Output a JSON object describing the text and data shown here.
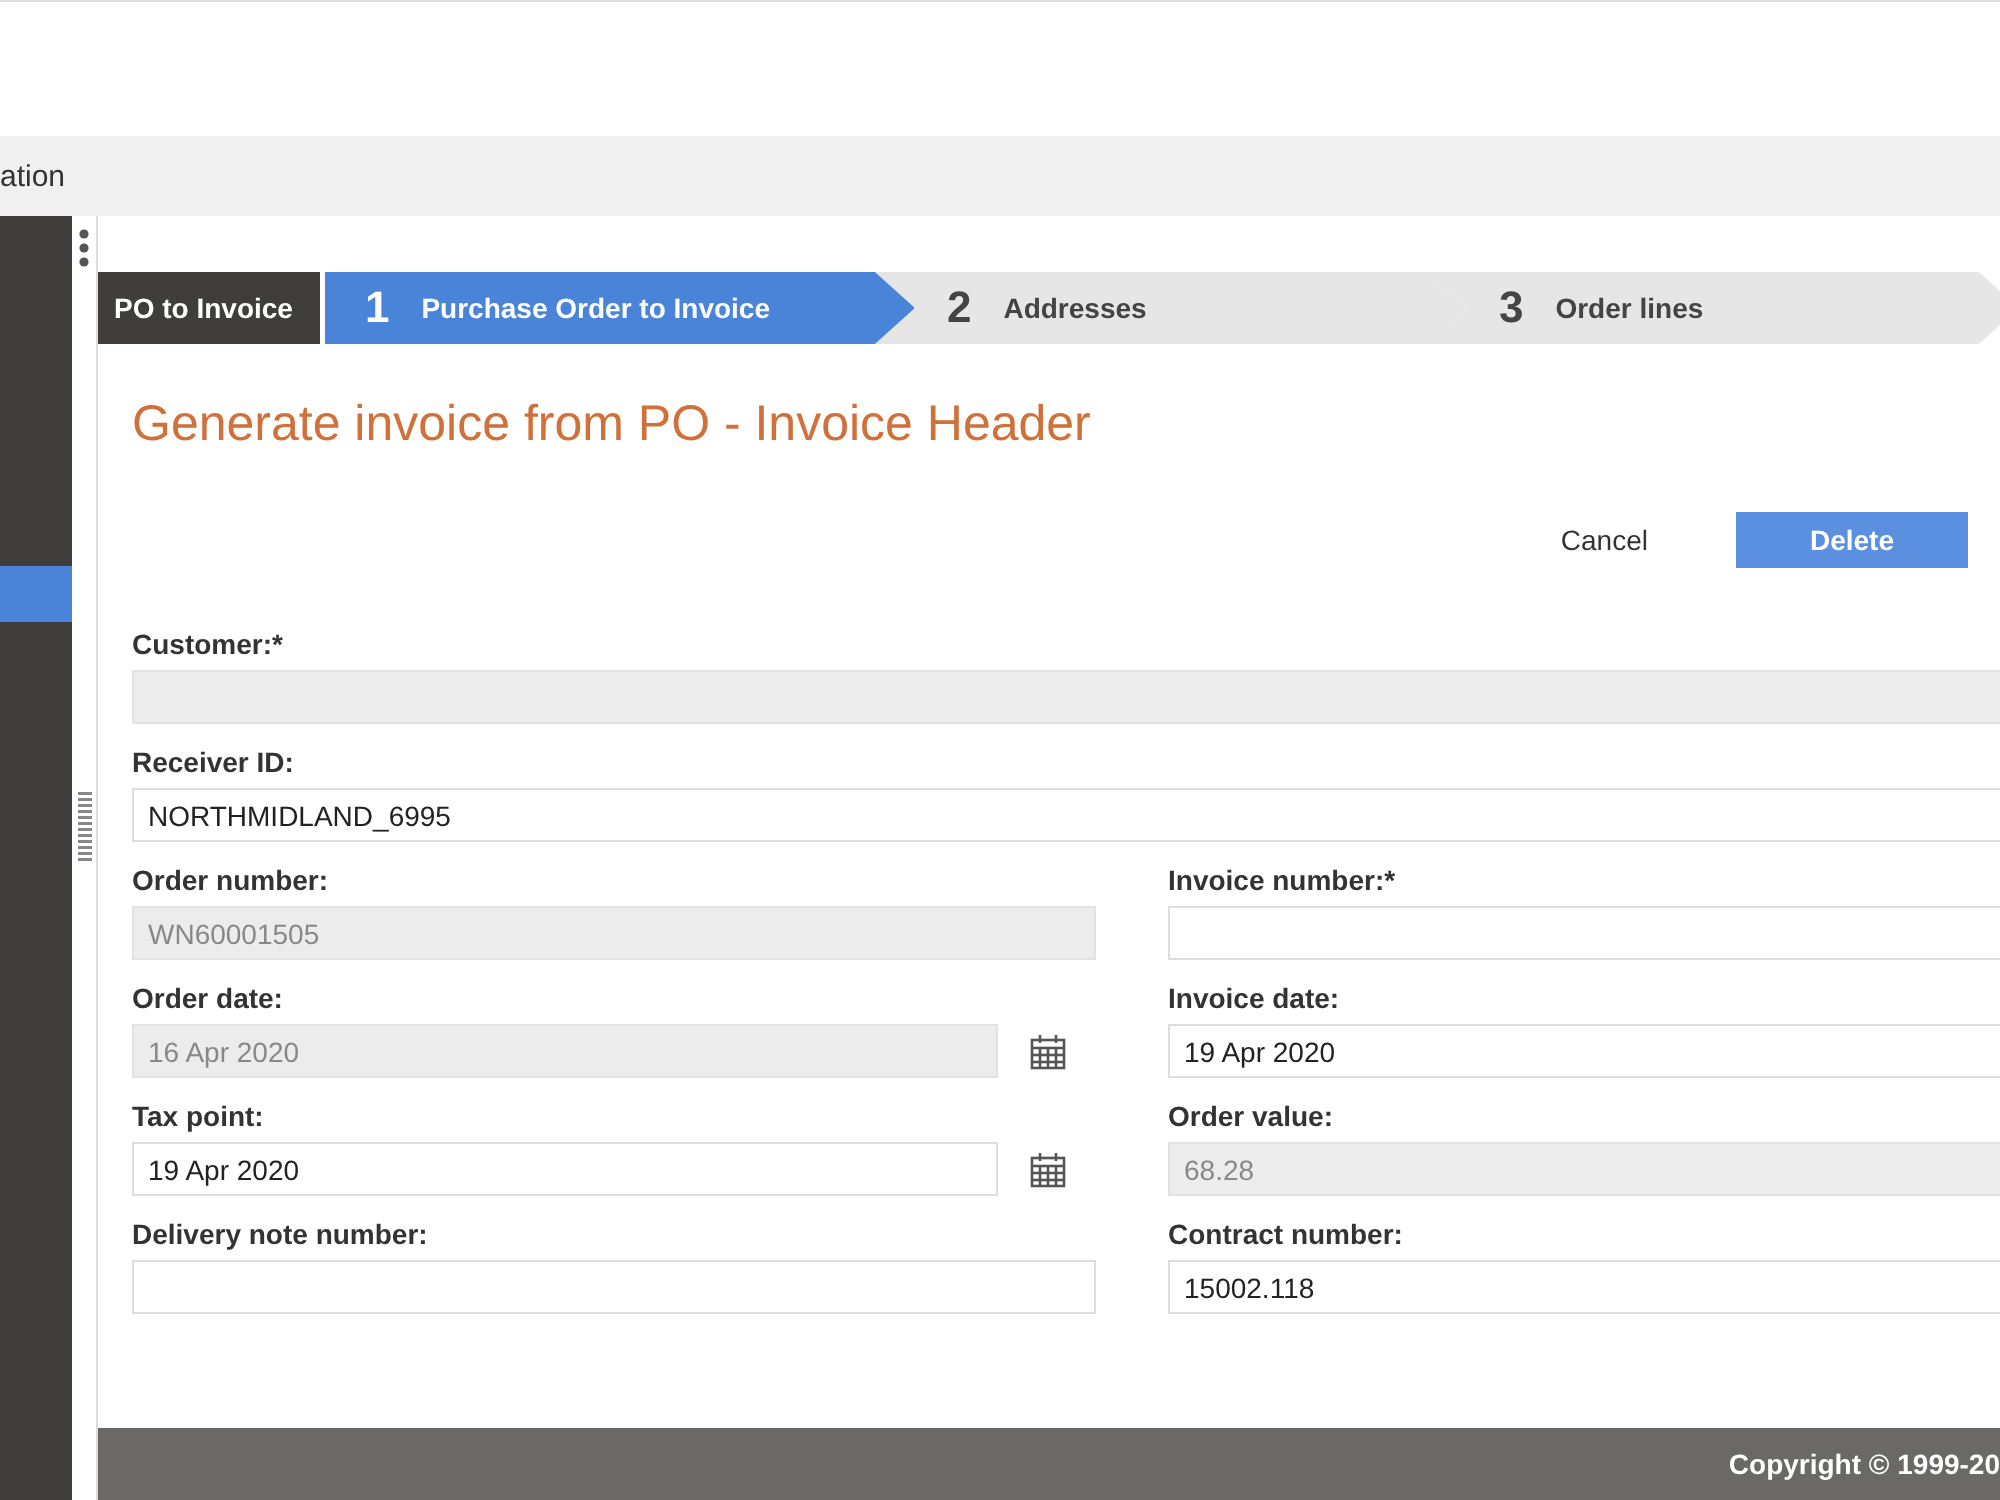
{
  "top_bar": {
    "title": "ation"
  },
  "sidebar": {
    "items": [
      {
        "selected": true
      }
    ]
  },
  "wizard": {
    "name": "PO to Invoice",
    "steps": [
      {
        "number": "1",
        "label": "Purchase Order to Invoice",
        "selected": true
      },
      {
        "number": "2",
        "label": "Addresses",
        "selected": false
      },
      {
        "number": "3",
        "label": "Order lines",
        "selected": false
      }
    ]
  },
  "page_title": "Generate invoice from PO - Invoice Header",
  "buttons": [
    {
      "label": "Cancel",
      "kind": "link"
    },
    {
      "label": "Delete",
      "kind": "primary"
    }
  ],
  "fields": [
    {
      "label": "Customer:*",
      "kind": "wide",
      "disabled": true
    },
    {
      "label": "Receiver ID:",
      "value": "NORTHMIDLAND_6995",
      "kind": "wide",
      "disabled": false
    },
    {
      "label": "Order number:",
      "value": "WN60001505",
      "kind": "text",
      "disabled": true
    },
    {
      "label": "Invoice number:*",
      "kind": "text",
      "disabled": false
    },
    {
      "label": "Order date:",
      "value": "16 Apr 2020",
      "kind": "date",
      "disabled": true
    },
    {
      "label": "Invoice date:",
      "value": "19 Apr 2020",
      "kind": "text",
      "disabled": false
    },
    {
      "label": "Tax point:",
      "value": "19 Apr 2020",
      "kind": "date",
      "disabled": false
    },
    {
      "label": "Order value:",
      "value": "68.28",
      "kind": "text",
      "disabled": true
    },
    {
      "label": "Delivery note number:",
      "kind": "text",
      "disabled": false
    },
    {
      "label": "Contract number:",
      "value": "15002.118",
      "kind": "text",
      "disabled": false
    }
  ],
  "footer": {
    "copyright": "Copyright © 1999-20"
  }
}
